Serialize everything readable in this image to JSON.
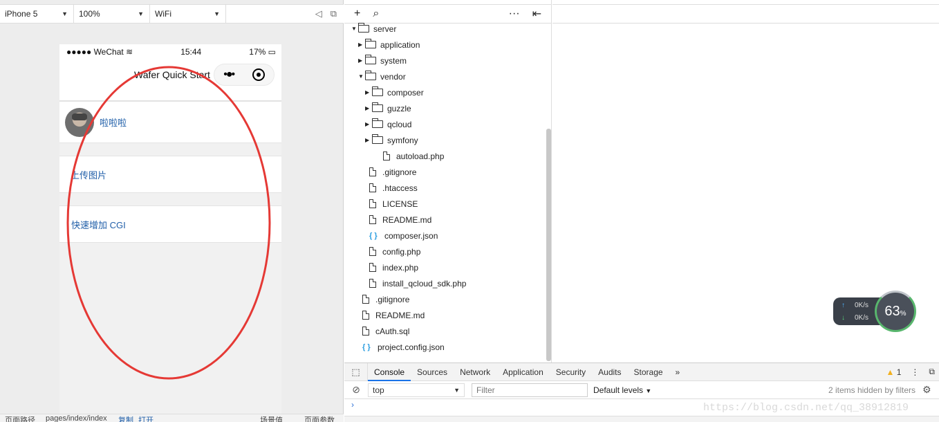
{
  "simulator": {
    "device": "iPhone 5",
    "zoom": "100%",
    "network": "WiFi",
    "status_bar": {
      "carrier": "●●●●● WeChat",
      "time": "15:44",
      "battery": "17%"
    },
    "nav_title": "Wafer Quick Start",
    "user_name": "啦啦啦",
    "upload_label": "上传图片",
    "cgi_label": "快速增加 CGI",
    "footer": {
      "path_label": "页面路径",
      "path": "pages/index/index",
      "copy": "复制",
      "open": "打开",
      "scene": "场景值",
      "params": "页面参数"
    }
  },
  "tree": {
    "rows": [
      {
        "name": "server",
        "kind": "folder-open"
      },
      {
        "name": "application",
        "kind": "folder"
      },
      {
        "name": "system",
        "kind": "folder"
      },
      {
        "name": "vendor",
        "kind": "folder-open"
      },
      {
        "name": "composer",
        "kind": "folder"
      },
      {
        "name": "guzzle",
        "kind": "folder"
      },
      {
        "name": "qcloud",
        "kind": "folder"
      },
      {
        "name": "symfony",
        "kind": "folder"
      },
      {
        "name": "autoload.php",
        "kind": "file"
      },
      {
        "name": ".gitignore",
        "kind": "file"
      },
      {
        "name": ".htaccess",
        "kind": "file"
      },
      {
        "name": "LICENSE",
        "kind": "file"
      },
      {
        "name": "README.md",
        "kind": "file"
      },
      {
        "name": "composer.json",
        "kind": "json"
      },
      {
        "name": "config.php",
        "kind": "file"
      },
      {
        "name": "index.php",
        "kind": "file"
      },
      {
        "name": "install_qcloud_sdk.php",
        "kind": "file"
      },
      {
        "name": ".gitignore",
        "kind": "file"
      },
      {
        "name": "README.md",
        "kind": "file"
      },
      {
        "name": "cAuth.sql",
        "kind": "file"
      },
      {
        "name": "project.config.json",
        "kind": "json"
      }
    ]
  },
  "net_widget": {
    "up": "0K/s",
    "down": "0K/s",
    "percent": "63",
    "percent_unit": "%"
  },
  "devtools": {
    "tabs": [
      "Console",
      "Sources",
      "Network",
      "Application",
      "Security",
      "Audits",
      "Storage"
    ],
    "active_tab": "Console",
    "warning_count": "1",
    "context": "top",
    "filter_placeholder": "Filter",
    "levels": "Default levels",
    "hidden_note": "2 items hidden by filters",
    "prompt": "›"
  },
  "watermark": "https://blog.csdn.net/qq_38912819",
  "colors": {
    "link": "#1f5ea8",
    "annotation": "#e53935",
    "active_tab": "#1a73e8"
  }
}
